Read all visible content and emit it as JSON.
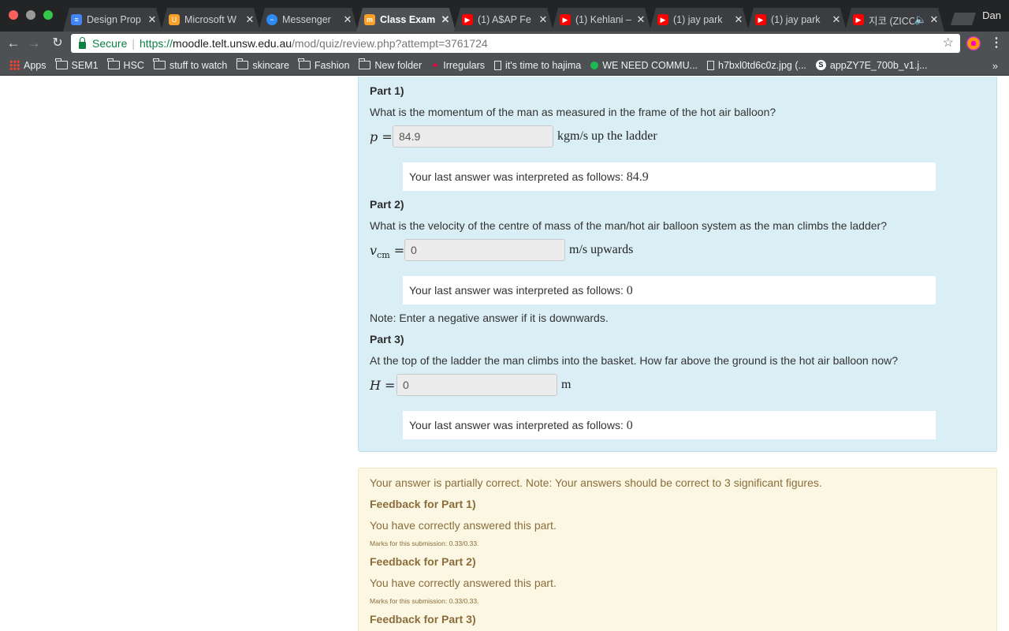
{
  "browser": {
    "user": "Dan",
    "tabs": [
      {
        "title": "Design Prop",
        "icon": "docs-icon",
        "color": "#4285f4"
      },
      {
        "title": "Microsoft W",
        "icon": "office-icon",
        "color": "#f7a12b"
      },
      {
        "title": "Messenger",
        "icon": "messenger-icon",
        "color": "#2c8cf4"
      },
      {
        "title": "Class Exam",
        "icon": "moodle-icon",
        "color": "#f7a12b"
      },
      {
        "title": "(1) A$AP Fe",
        "icon": "youtube-icon",
        "color": "#ff0000"
      },
      {
        "title": "(1) Kehlani –",
        "icon": "youtube-icon",
        "color": "#ff0000"
      },
      {
        "title": "(1) jay park",
        "icon": "youtube-icon",
        "color": "#ff0000"
      },
      {
        "title": "(1) jay park",
        "icon": "youtube-icon",
        "color": "#ff0000"
      },
      {
        "title": "지코 (ZICO",
        "icon": "youtube-icon",
        "color": "#ff0000"
      }
    ],
    "address": {
      "secure_label": "Secure",
      "scheme": "https://",
      "host": "moodle.telt.unsw.edu.au",
      "path": "/mod/quiz/review.php?attempt=3761724"
    },
    "bookmarks": [
      {
        "label": "Apps",
        "icon": "apps-icon"
      },
      {
        "label": "SEM1",
        "icon": "folder-icon"
      },
      {
        "label": "HSC",
        "icon": "folder-icon"
      },
      {
        "label": "stuff to watch",
        "icon": "folder-icon"
      },
      {
        "label": "skincare",
        "icon": "folder-icon"
      },
      {
        "label": "Fashion",
        "icon": "folder-icon"
      },
      {
        "label": "New folder",
        "icon": "folder-icon"
      },
      {
        "label": "Irregulars",
        "icon": "site-icon"
      },
      {
        "label": "it's time to hajima",
        "icon": "page-icon"
      },
      {
        "label": "WE NEED COMMU...",
        "icon": "spotify-icon"
      },
      {
        "label": "h7bxl0td6c0z.jpg (...",
        "icon": "page-icon"
      },
      {
        "label": "appZY7E_700b_v1.j...",
        "icon": "s-icon"
      }
    ]
  },
  "question": {
    "parts": [
      {
        "heading": "Part 1)",
        "text": "What is the momentum of the man as measured in the frame of the hot air balloon?",
        "symbol": "p",
        "subscript": "",
        "value": "84.9",
        "unit": "kgm/s up the ladder",
        "interp_label": "Your last answer was interpreted as follows:",
        "interp_value": "84.9"
      },
      {
        "heading": "Part 2)",
        "text": "What is the velocity of the centre of mass of the man/hot air balloon system as the man climbs the ladder?",
        "symbol": "v",
        "subscript": "cm",
        "value": "0",
        "unit": "m/s upwards",
        "interp_label": "Your last answer was interpreted as follows:",
        "interp_value": "0",
        "note": "Note: Enter a negative answer if it is downwards."
      },
      {
        "heading": "Part 3)",
        "text": "At the top of the ladder the man climbs into the basket. How far above the ground is the hot air balloon now?",
        "symbol": "H",
        "subscript": "",
        "value": "0",
        "unit": "m",
        "interp_label": "Your last answer was interpreted as follows:",
        "interp_value": "0"
      }
    ]
  },
  "feedback": {
    "summary": "Your answer is partially correct. Note: Your answers should be correct to 3 significant figures.",
    "parts": [
      {
        "heading": "Feedback for Part 1)",
        "text": "You have correctly answered this part.",
        "marks": "Marks for this submission: 0.33/0.33."
      },
      {
        "heading": "Feedback for Part 2)",
        "text": "You have correctly answered this part.",
        "marks": "Marks for this submission: 0.33/0.33."
      },
      {
        "heading": "Feedback for Part 3)"
      }
    ]
  }
}
